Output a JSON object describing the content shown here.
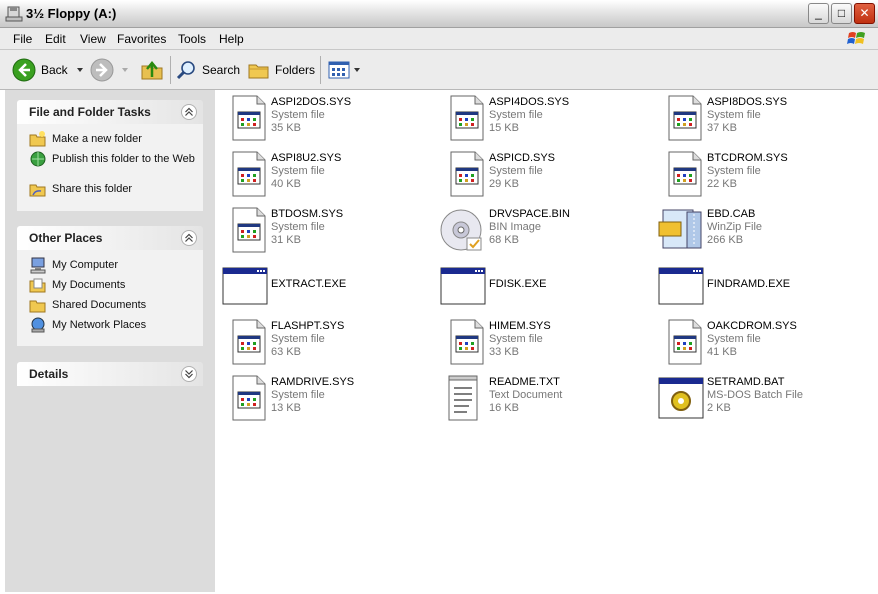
{
  "window": {
    "title": "3½ Floppy (A:)",
    "min_glyph": "_",
    "max_glyph": "□",
    "close_glyph": "✕"
  },
  "menu": [
    "File",
    "Edit",
    "View",
    "Favorites",
    "Tools",
    "Help"
  ],
  "toolbar": {
    "back": "Back",
    "search": "Search",
    "folders": "Folders"
  },
  "tasks_panel": {
    "title": "File and Folder Tasks",
    "items": [
      "Make a new folder",
      "Publish this folder to the Web",
      "Share this folder"
    ]
  },
  "places_panel": {
    "title": "Other Places",
    "items": [
      "My Computer",
      "My Documents",
      "Shared Documents",
      "My Network Places"
    ]
  },
  "details_panel": {
    "title": "Details"
  },
  "files": [
    {
      "name": "ASPI2DOS.SYS",
      "type": "System file",
      "size": "35 KB",
      "icon": "system-file-icon"
    },
    {
      "name": "ASPI4DOS.SYS",
      "type": "System file",
      "size": "15 KB",
      "icon": "system-file-icon"
    },
    {
      "name": "ASPI8DOS.SYS",
      "type": "System file",
      "size": "37 KB",
      "icon": "system-file-icon"
    },
    {
      "name": "ASPI8U2.SYS",
      "type": "System file",
      "size": "40 KB",
      "icon": "system-file-icon"
    },
    {
      "name": "ASPICD.SYS",
      "type": "System file",
      "size": "29 KB",
      "icon": "system-file-icon"
    },
    {
      "name": "BTCDROM.SYS",
      "type": "System file",
      "size": "22 KB",
      "icon": "system-file-icon"
    },
    {
      "name": "BTDOSM.SYS",
      "type": "System file",
      "size": "31 KB",
      "icon": "system-file-icon"
    },
    {
      "name": "DRVSPACE.BIN",
      "type": "BIN Image",
      "size": "68 KB",
      "icon": "disc-image-icon"
    },
    {
      "name": "EBD.CAB",
      "type": "WinZip File",
      "size": "266 KB",
      "icon": "winzip-icon"
    },
    {
      "name": "EXTRACT.EXE",
      "type": "",
      "size": "",
      "icon": "executable-icon"
    },
    {
      "name": "FDISK.EXE",
      "type": "",
      "size": "",
      "icon": "executable-icon"
    },
    {
      "name": "FINDRAMD.EXE",
      "type": "",
      "size": "",
      "icon": "executable-icon"
    },
    {
      "name": "FLASHPT.SYS",
      "type": "System file",
      "size": "63 KB",
      "icon": "system-file-icon"
    },
    {
      "name": "HIMEM.SYS",
      "type": "System file",
      "size": "33 KB",
      "icon": "system-file-icon"
    },
    {
      "name": "OAKCDROM.SYS",
      "type": "System file",
      "size": "41 KB",
      "icon": "system-file-icon"
    },
    {
      "name": "RAMDRIVE.SYS",
      "type": "System file",
      "size": "13 KB",
      "icon": "system-file-icon"
    },
    {
      "name": "README.TXT",
      "type": "Text Document",
      "size": "16 KB",
      "icon": "text-document-icon"
    },
    {
      "name": "SETRAMD.BAT",
      "type": "MS-DOS Batch File",
      "size": "2 KB",
      "icon": "batch-file-icon"
    }
  ]
}
